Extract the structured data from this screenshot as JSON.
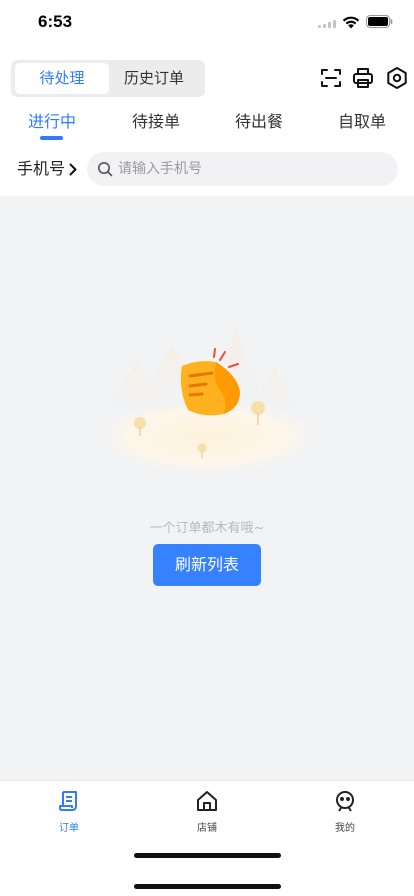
{
  "status_bar": {
    "time": "6:53"
  },
  "header": {
    "segments": [
      "待处理",
      "历史订单"
    ],
    "active_segment": "待处理",
    "icons": [
      "scan-icon",
      "printer-icon",
      "settings-icon"
    ]
  },
  "status_tabs": {
    "items": [
      "进行中",
      "待接单",
      "待出餐",
      "自取单"
    ],
    "active": "进行中"
  },
  "search": {
    "filter_label": "手机号",
    "placeholder": "请输入手机号",
    "value": ""
  },
  "empty_state": {
    "message": "一个订单都木有哦~",
    "refresh_label": "刷新列表"
  },
  "tab_bar": {
    "items": [
      {
        "label": "订单",
        "icon": "order-icon",
        "active": true
      },
      {
        "label": "店铺",
        "icon": "store-icon",
        "active": false
      },
      {
        "label": "我的",
        "icon": "profile-icon",
        "active": false
      }
    ]
  },
  "colors": {
    "accent": "#2f7bff",
    "button": "#3581ff",
    "page_bg": "#f2f3f5",
    "illustration_orange": "#ffb21e"
  }
}
